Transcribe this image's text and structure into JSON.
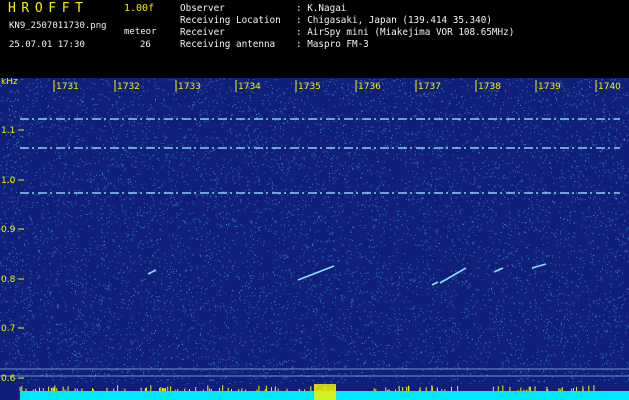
{
  "header": {
    "app_name": "HROFFT",
    "version": "1.00f",
    "filename": "KN9_2507011730.png",
    "meteor_label": "meteor",
    "datetime": "25.07.01 17:30",
    "meteor_count": "26",
    "info": [
      {
        "key": "Observer",
        "value": "K.Nagai"
      },
      {
        "key": "Receiving Location",
        "value": "Chigasaki, Japan (139.414 35.340)"
      },
      {
        "key": "Receiver",
        "value": "AirSpy mini (Miakejima VOR 108.65MHz)"
      },
      {
        "key": "Receiving antenna",
        "value": "Maspro FM-3"
      }
    ]
  },
  "spectrogram": {
    "y_unit": "kHz",
    "y_ticks": [
      "1.1",
      "1.0",
      "0.9",
      "0.8",
      "0.7",
      "0.6"
    ],
    "time_ticks": [
      "1731",
      "1732",
      "1733",
      "1734",
      "1735",
      "1736",
      "1737",
      "1738",
      "1739",
      "1740"
    ],
    "colors": {
      "background": "#10207a",
      "noise": "#3aa0e8",
      "trace": "#9cf2ff",
      "label": "#f2f200",
      "baseline": "#00e8ff"
    }
  }
}
